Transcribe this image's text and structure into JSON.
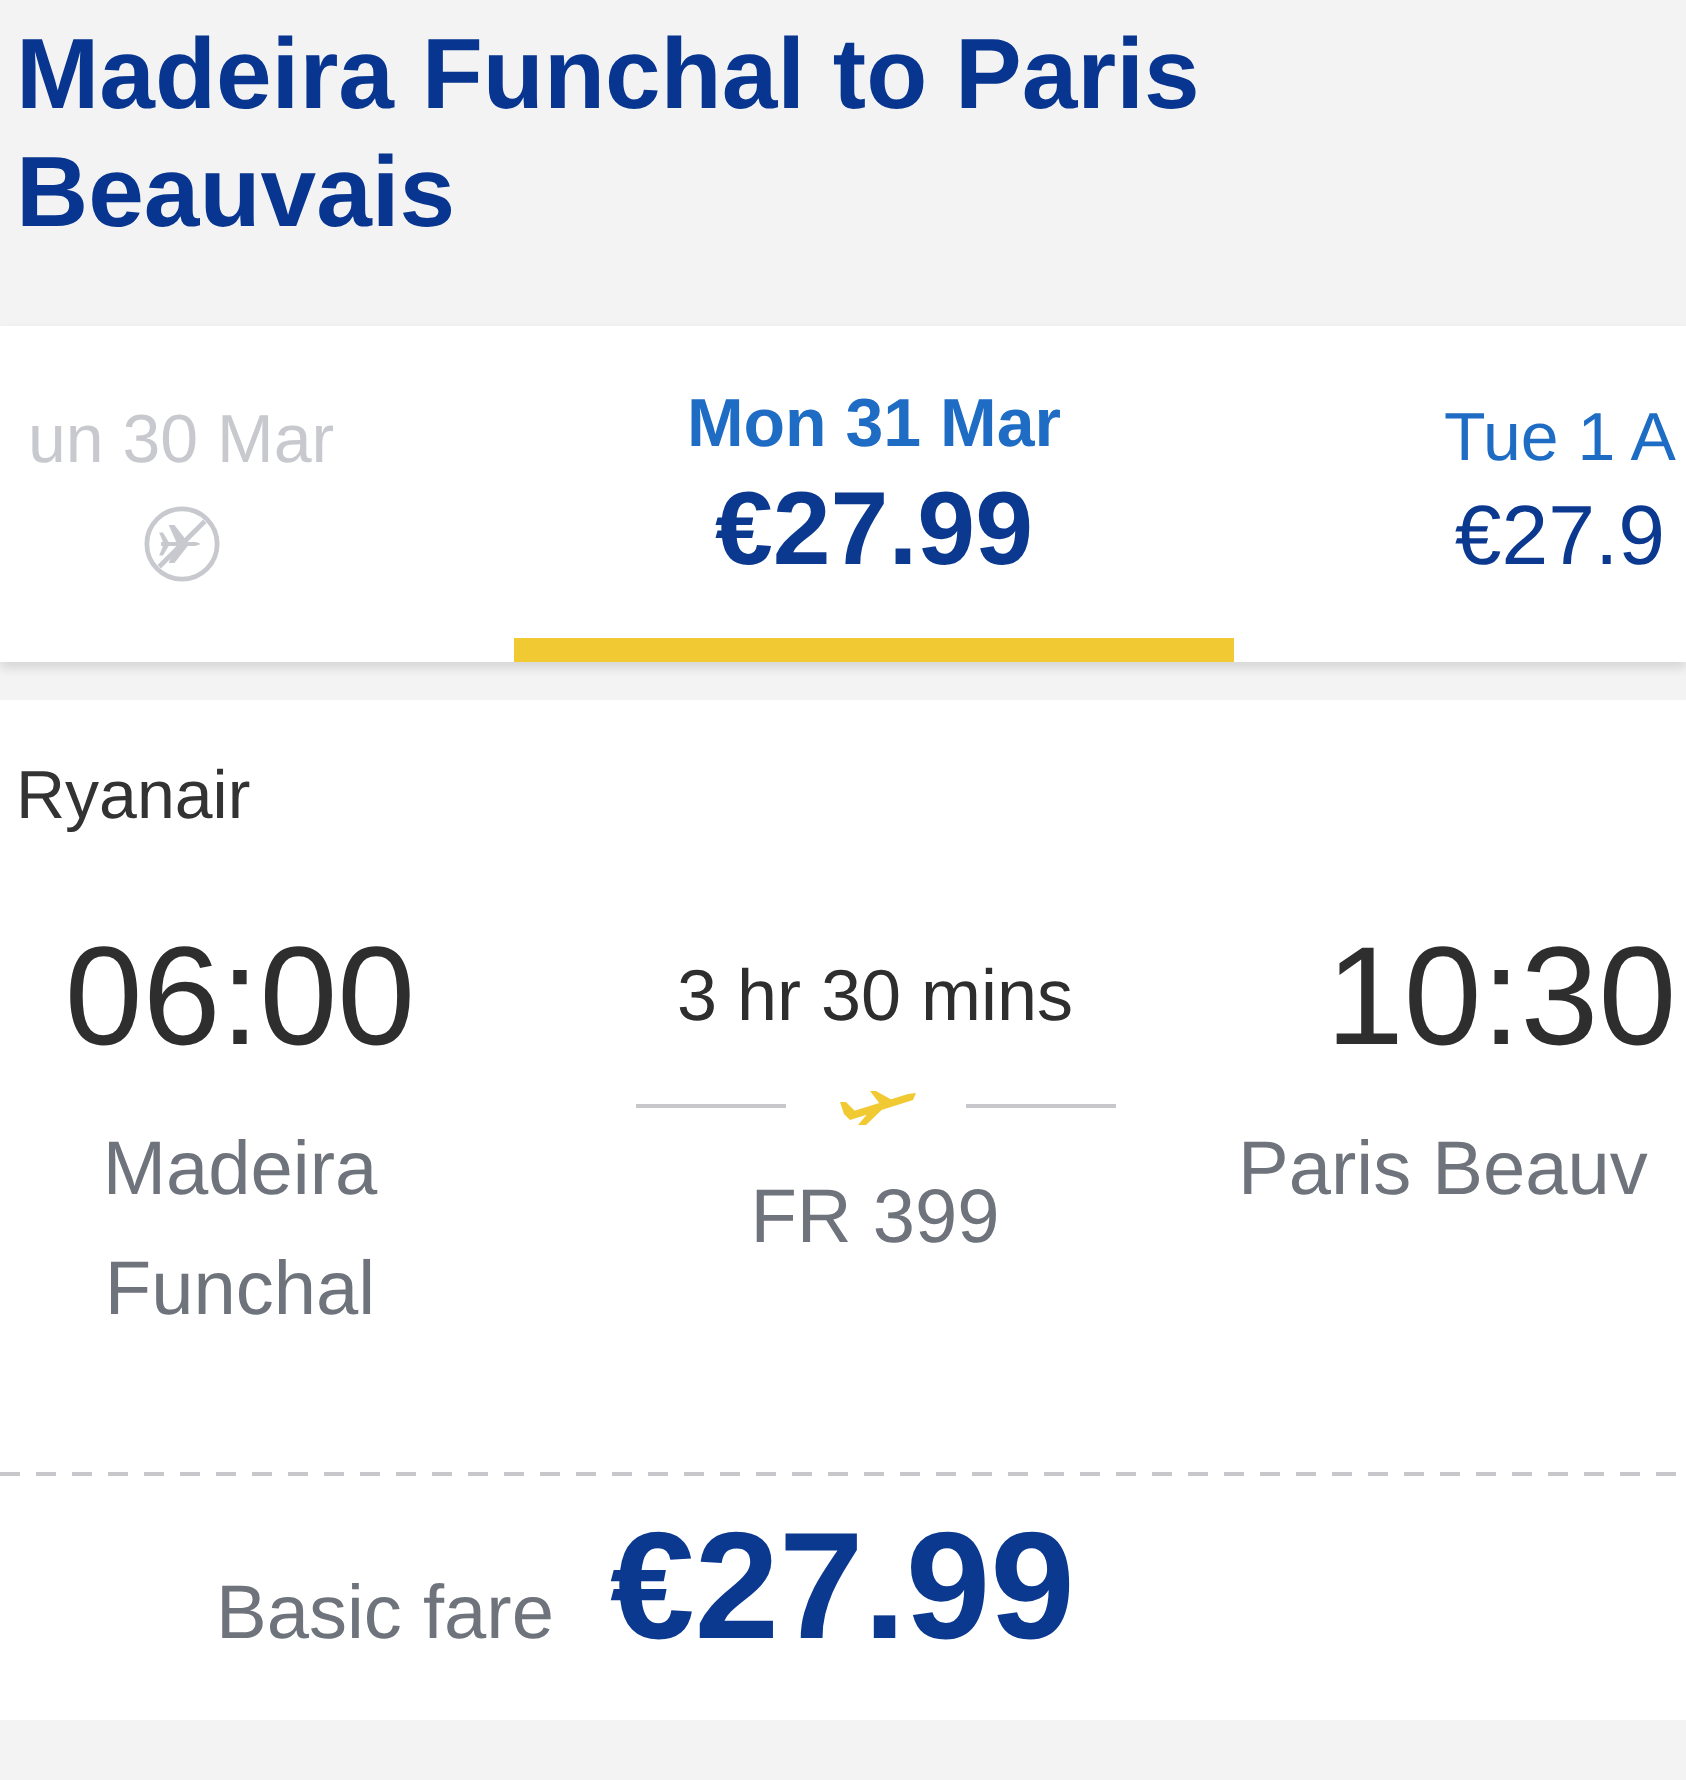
{
  "title": "Madeira Funchal to Paris Beauvais",
  "date_tabs": [
    {
      "date": "un 30 Mar",
      "disabled": true,
      "selected": false
    },
    {
      "date": "Mon 31 Mar",
      "price": "€27.99",
      "disabled": false,
      "selected": true
    },
    {
      "date": "Tue 1 A",
      "price": "€27.9",
      "disabled": false,
      "selected": false
    }
  ],
  "flight": {
    "airline": "Ryanair",
    "departure": {
      "time": "06:00",
      "airport": "Madeira Funchal"
    },
    "duration": "3 hr 30 mins",
    "flight_number": "FR 399",
    "arrival": {
      "time": "10:30",
      "airport": "Paris Beauv"
    }
  },
  "fare": {
    "label": "Basic fare",
    "price": "€27.99"
  }
}
